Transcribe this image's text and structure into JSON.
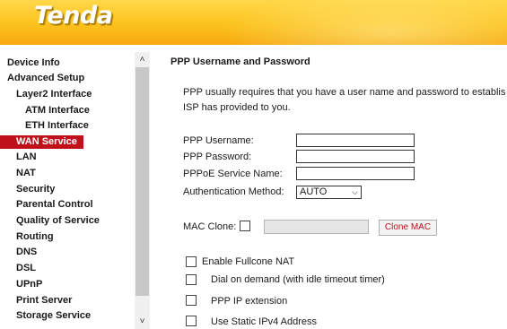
{
  "header": {
    "logo": "Tenda"
  },
  "sidebar": {
    "items": [
      {
        "label": "Device Info"
      },
      {
        "label": "Advanced Setup"
      },
      {
        "label": "Layer2 Interface"
      },
      {
        "label": "ATM Interface"
      },
      {
        "label": "ETH Interface"
      },
      {
        "label": "WAN Service",
        "active": true
      },
      {
        "label": "LAN"
      },
      {
        "label": "NAT"
      },
      {
        "label": "Security"
      },
      {
        "label": "Parental Control"
      },
      {
        "label": "Quality of Service"
      },
      {
        "label": "Routing"
      },
      {
        "label": "DNS"
      },
      {
        "label": "DSL"
      },
      {
        "label": "UPnP"
      },
      {
        "label": "Print Server"
      },
      {
        "label": "Storage Service"
      }
    ]
  },
  "main": {
    "title": "PPP Username and Password",
    "description_line1": "PPP usually requires that you have a user name and password to establis",
    "description_line2": "ISP has provided to you.",
    "fields": {
      "username_label": "PPP Username:",
      "username_value": "",
      "password_label": "PPP Password:",
      "password_value": "",
      "service_label": "PPPoE Service Name:",
      "service_value": "",
      "auth_label": "Authentication Method:",
      "auth_value": "AUTO"
    },
    "mac_clone": {
      "label": "MAC Clone:",
      "value": "",
      "button_label": "Clone MAC"
    },
    "options": [
      {
        "label": "Enable Fullcone NAT",
        "checked": false
      },
      {
        "label": "Dial on demand (with idle timeout timer)",
        "checked": false
      },
      {
        "label": "PPP IP extension",
        "checked": false
      },
      {
        "label": "Use Static IPv4 Address",
        "checked": false
      }
    ]
  },
  "colors": {
    "accent": "#c0101a",
    "header_gold": "#fcc21c"
  }
}
